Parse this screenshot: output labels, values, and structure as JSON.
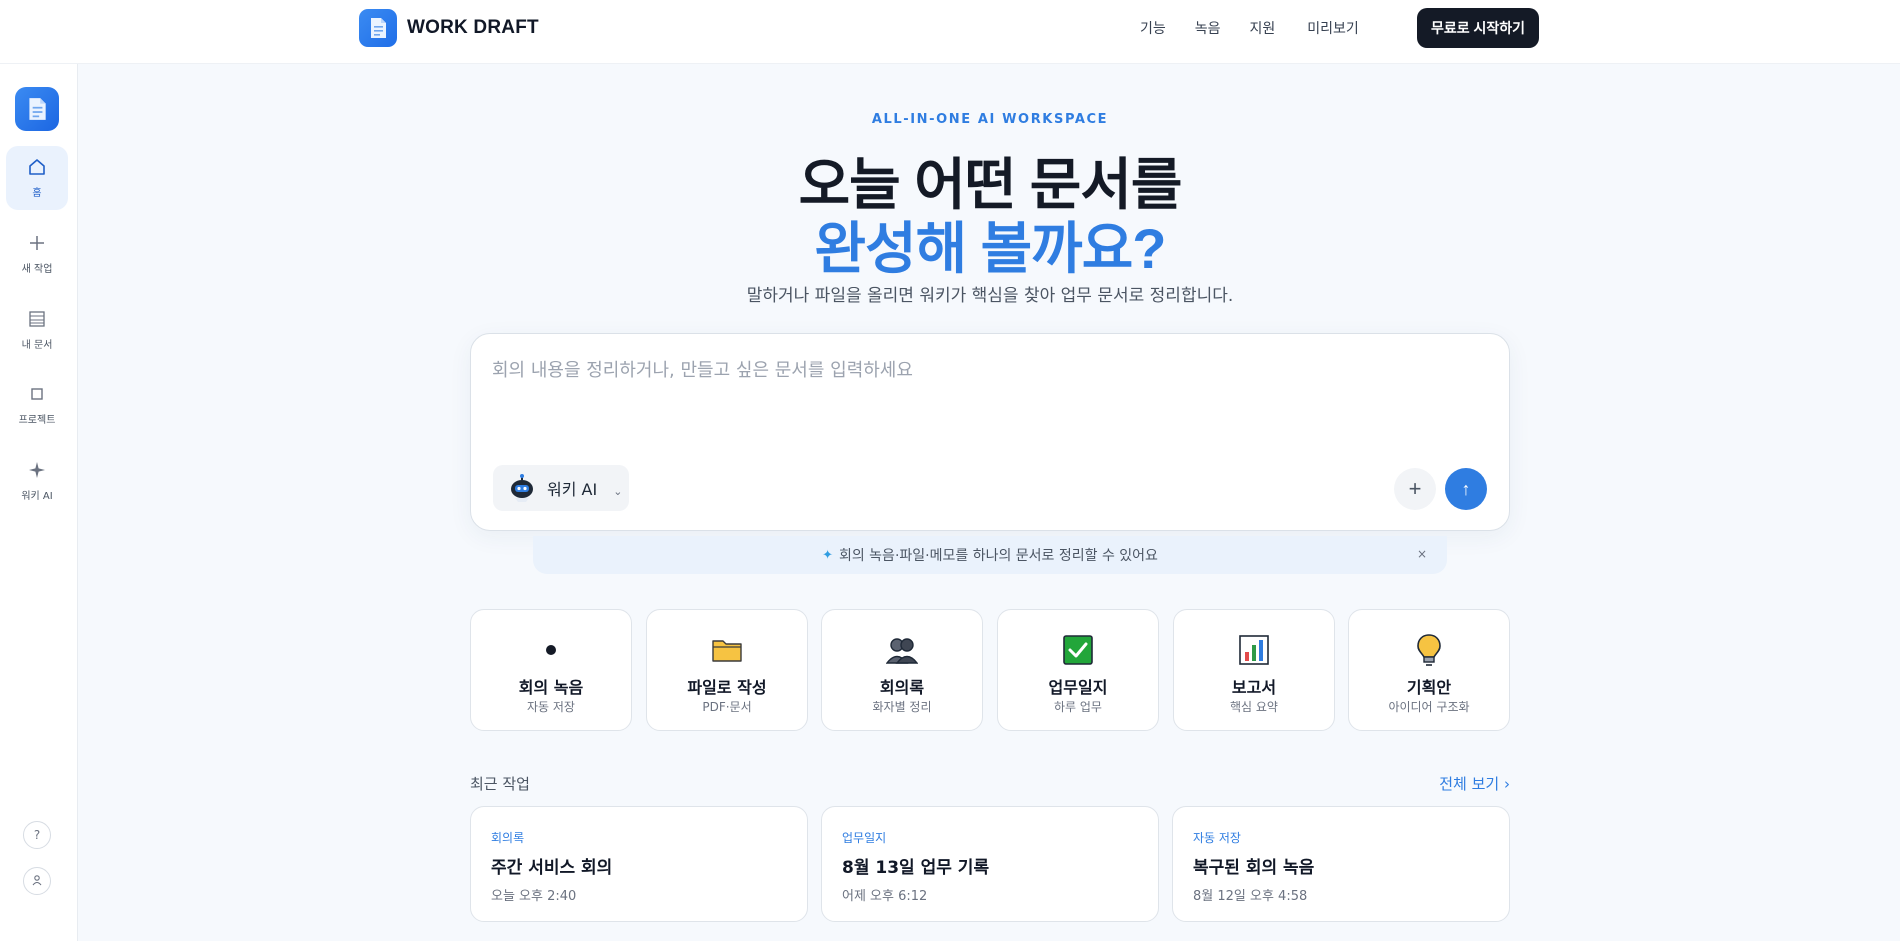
{
  "brand": {
    "name": "WORK DRAFT",
    "logo_icon": "document-icon"
  },
  "nav": {
    "items": [
      "기능",
      "녹음",
      "지원",
      "미리보기"
    ],
    "cta": "무료로 시작하기"
  },
  "sidebar": {
    "items": [
      {
        "label": "홈",
        "icon": "home-icon",
        "active": true
      },
      {
        "label": "새 작업",
        "icon": "plus-icon"
      },
      {
        "label": "내 문서",
        "icon": "list-icon"
      },
      {
        "label": "프로젝트",
        "icon": "square-icon"
      },
      {
        "label": "워키 AI",
        "icon": "sparkle-icon"
      }
    ],
    "help": "?",
    "profile_icon": "user-icon"
  },
  "hero": {
    "eyebrow": "ALL-IN-ONE AI WORKSPACE",
    "title_line1": "오늘 어떤 문서를",
    "title_line2": "완성해 볼까요?",
    "subtitle": "말하거나 파일을 올리면 워키가 핵심을 찾아 업무 문서로 정리합니다."
  },
  "composer": {
    "placeholder": "회의 내용을 정리하거나, 만들고 싶은 문서를 입력하세요",
    "model": "워키 AI",
    "model_chevron": "⌄",
    "add": "+",
    "send": "↑"
  },
  "tip": {
    "icon": "✦",
    "text": "회의 녹음·파일·메모를 하나의 문서로 정리할 수 있어요",
    "close": "×"
  },
  "quick_cards": [
    {
      "title": "회의 녹음",
      "sub": "자동 저장",
      "icon": "record-dot-icon"
    },
    {
      "title": "파일로 작성",
      "sub": "PDF·문서",
      "icon": "folder-icon"
    },
    {
      "title": "회의록",
      "sub": "화자별 정리",
      "icon": "people-icon"
    },
    {
      "title": "업무일지",
      "sub": "하루 업무",
      "icon": "checkbox-icon"
    },
    {
      "title": "보고서",
      "sub": "핵심 요약",
      "icon": "bar-chart-icon"
    },
    {
      "title": "기획안",
      "sub": "아이디어 구조화",
      "icon": "lightbulb-icon"
    }
  ],
  "recent": {
    "title": "최근 작업",
    "view_all": "전체 보기 ›",
    "items": [
      {
        "tag": "회의록",
        "name": "주간 서비스 회의",
        "time": "오늘 오후 2:40"
      },
      {
        "tag": "업무일지",
        "name": "8월 13일 업무 기록",
        "time": "어제 오후 6:12"
      },
      {
        "tag": "자동 저장",
        "name": "복구된 회의 녹음",
        "time": "8월 12일 오후 4:58"
      }
    ]
  },
  "colors": {
    "accent": "#2f7de1",
    "dark": "#141a26",
    "page_bg": "#f6f9fd"
  }
}
